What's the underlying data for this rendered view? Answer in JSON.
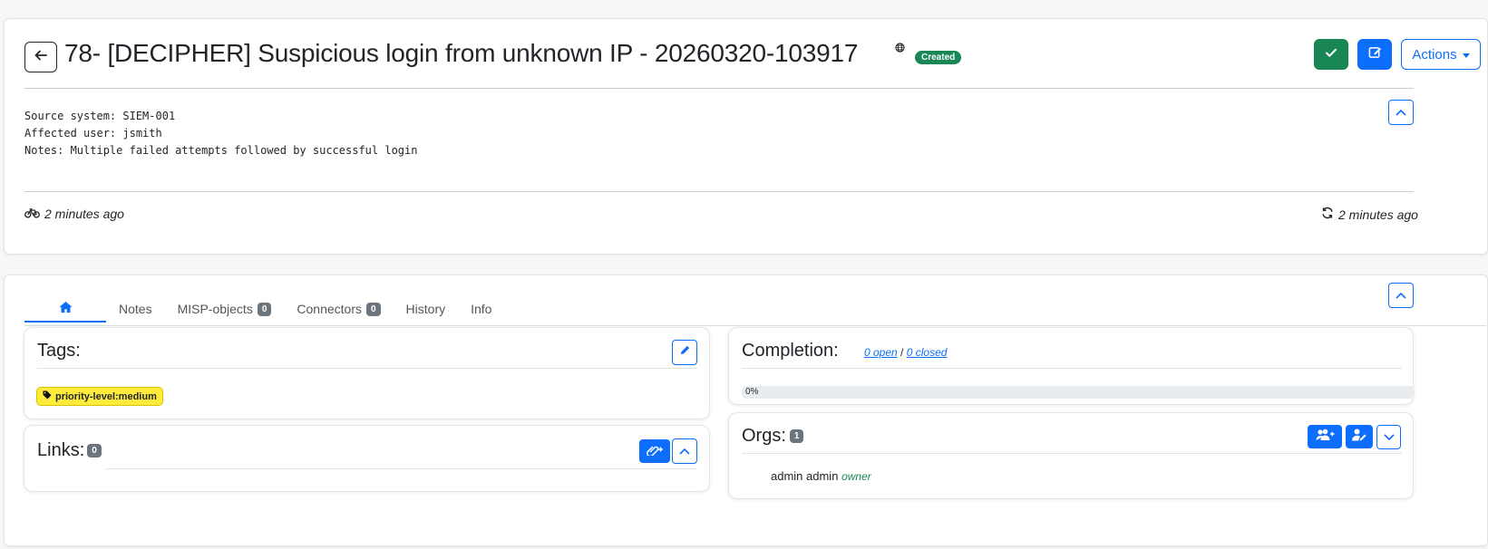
{
  "case": {
    "title": "78- [DECIPHER] Suspicious login from unknown IP - 20260320-103917",
    "status_badge": "Created",
    "description_lines": [
      "Source system: SIEM-001",
      "Affected user: jsmith",
      "Notes: Multiple failed attempts followed by successful login"
    ],
    "created_ago": "2 minutes ago",
    "updated_ago": "2 minutes ago"
  },
  "header_actions": {
    "actions_label": "Actions"
  },
  "tabs": [
    {
      "label": "Notes"
    },
    {
      "label": "MISP-objects",
      "count": "0"
    },
    {
      "label": "Connectors",
      "count": "0"
    },
    {
      "label": "History"
    },
    {
      "label": "Info"
    }
  ],
  "tags": {
    "title": "Tags:",
    "items": [
      "priority-level:medium"
    ]
  },
  "links": {
    "title": "Links:",
    "count": "0"
  },
  "completion": {
    "title": "Completion:",
    "open_link": "0 open",
    "separator": "/",
    "closed_link": "0 closed",
    "progress_label": "0%",
    "progress_fraction": 0
  },
  "orgs": {
    "title": "Orgs:",
    "count": "1",
    "members": [
      {
        "name": "admin admin",
        "role": "owner"
      }
    ]
  },
  "colors": {
    "primary": "#0d6efd",
    "success": "#198754",
    "tag": "#ffeb3b",
    "owner": "#198754"
  },
  "icons": [
    "arrow-left-icon",
    "globe-icon",
    "check-icon",
    "edit-icon",
    "caret-down-icon",
    "chevron-up-icon",
    "chevron-down-icon",
    "bicycle-icon",
    "refresh-icon",
    "home-icon",
    "pen-icon",
    "tag-icon",
    "link-add-icon",
    "users-add-icon",
    "user-edit-icon"
  ]
}
